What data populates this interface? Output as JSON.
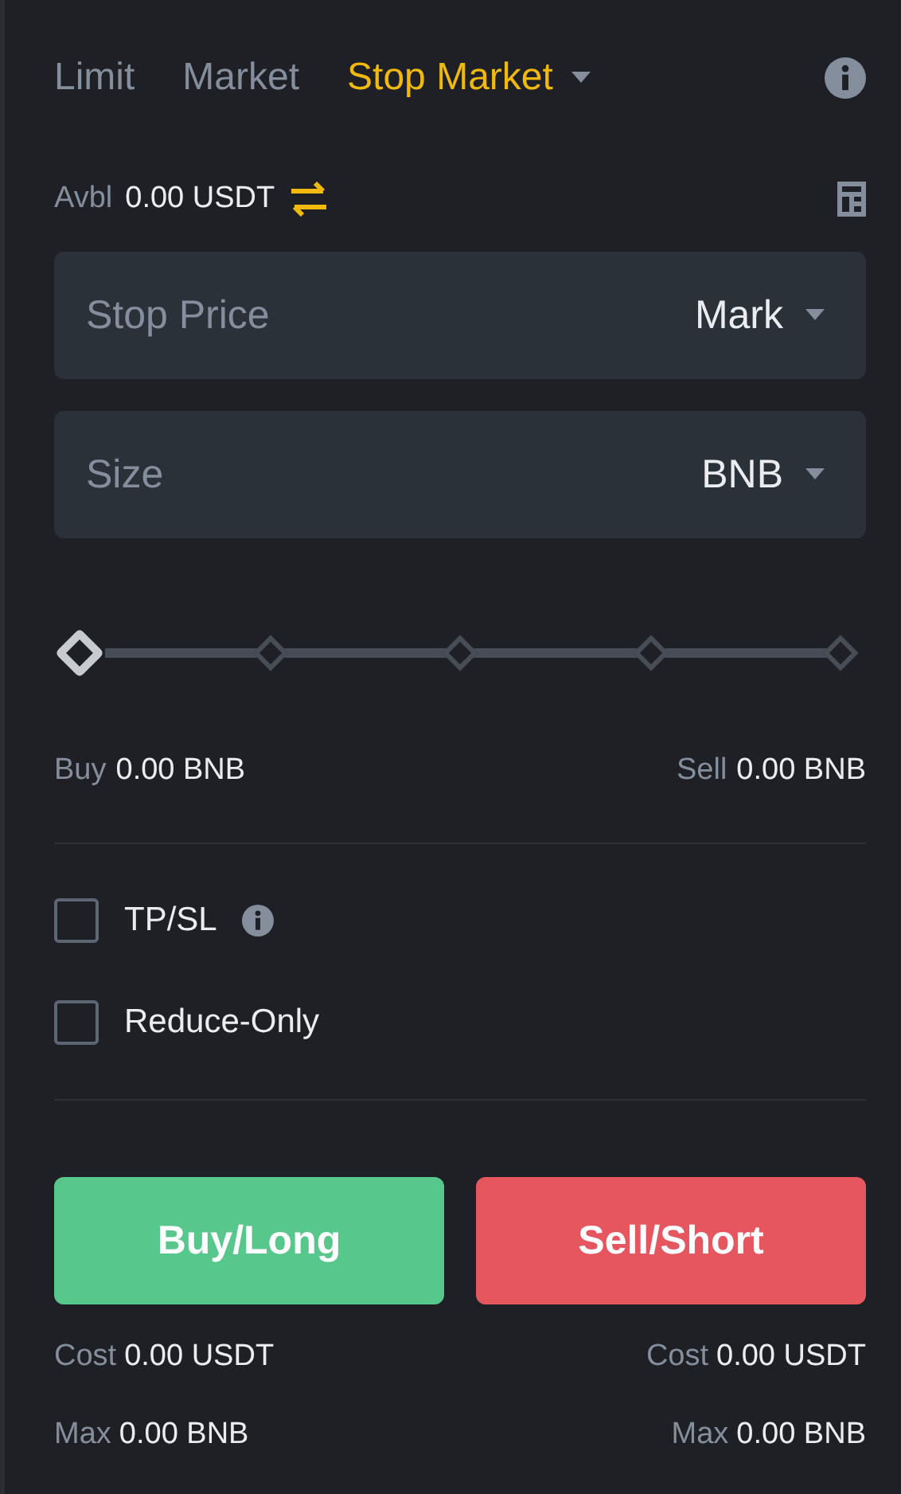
{
  "order_types": [
    {
      "label": "Limit",
      "selected": false,
      "dropdown": false
    },
    {
      "label": "Market",
      "selected": false,
      "dropdown": false
    },
    {
      "label": "Stop Market",
      "selected": true,
      "dropdown": true
    }
  ],
  "available": {
    "label": "Avbl",
    "value": "0.00 USDT"
  },
  "fields": [
    {
      "placeholder": "Stop Price",
      "unit": "Mark"
    },
    {
      "placeholder": "Size",
      "unit": "BNB"
    }
  ],
  "slider": {
    "level": 0
  },
  "amounts": [
    {
      "label": "Buy",
      "value": "0.00 BNB"
    },
    {
      "label": "Sell",
      "value": "0.00 BNB"
    }
  ],
  "options": [
    {
      "label": "TP/SL",
      "checked": false,
      "info": true
    },
    {
      "label": "Reduce-Only",
      "checked": false,
      "info": false
    }
  ],
  "actions": [
    {
      "label": "Buy/Long",
      "kind": "buy"
    },
    {
      "label": "Sell/Short",
      "kind": "sell"
    }
  ],
  "summary": [
    {
      "label": "Cost",
      "value": "0.00 USDT"
    },
    {
      "label": "Cost",
      "value": "0.00 USDT"
    },
    {
      "label": "Max",
      "value": "0.00 BNB"
    },
    {
      "label": "Max",
      "value": "0.00 BNB"
    }
  ]
}
